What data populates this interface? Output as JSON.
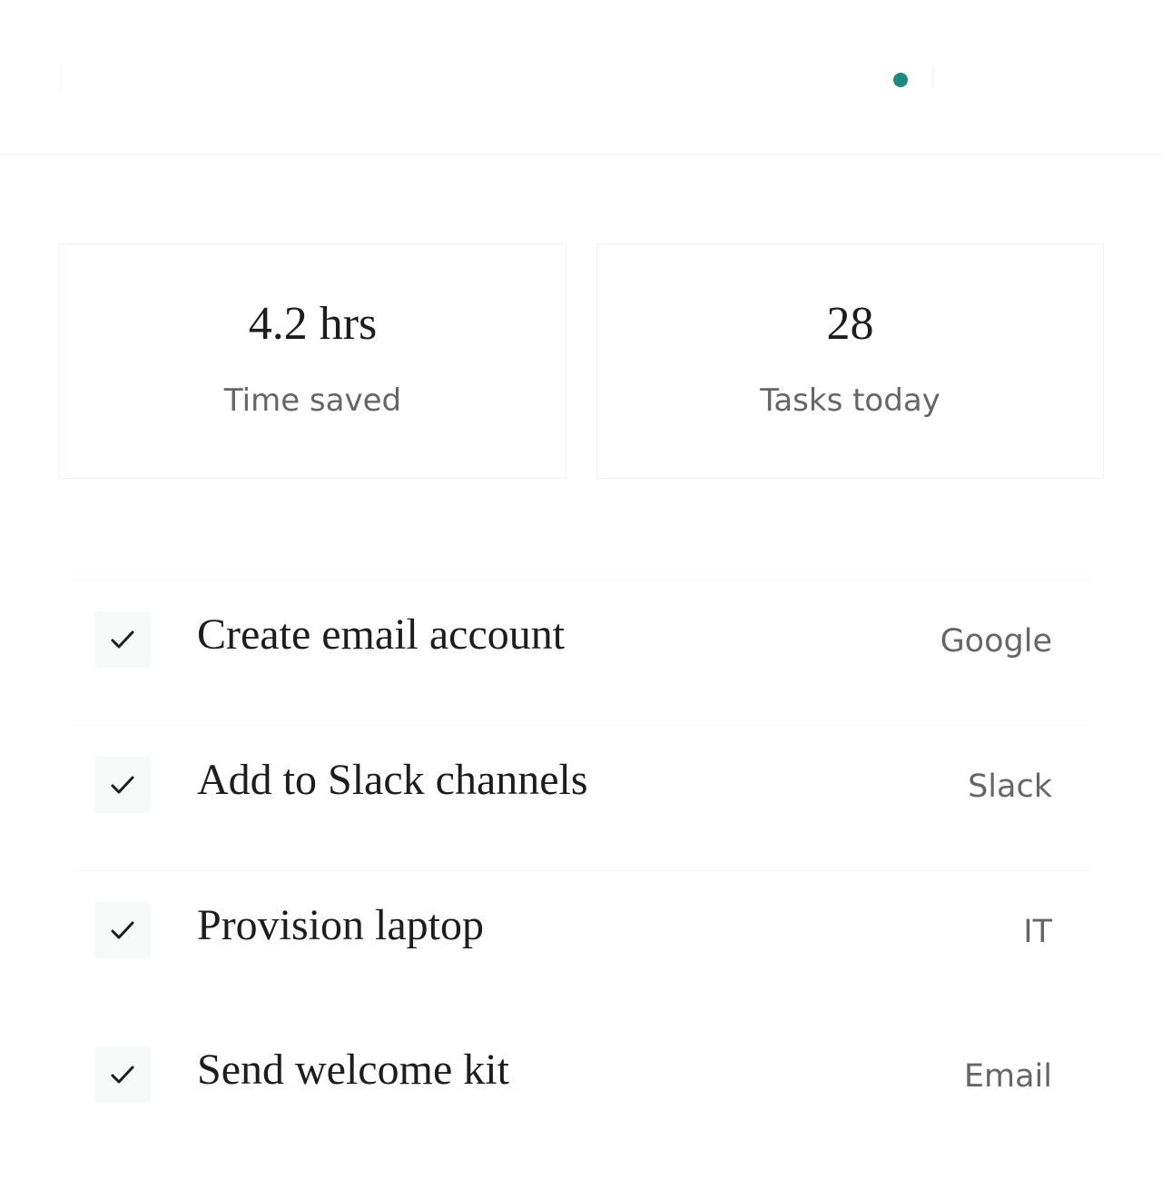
{
  "theme": {
    "accent": "#1e8a7e",
    "text_primary": "#1d1d1d",
    "text_secondary": "#666666",
    "check_bg": "#f6fbfa"
  },
  "header": {
    "status_indicator": {
      "color": "#1e8a7e",
      "state": "active"
    }
  },
  "stats": [
    {
      "value": "4.2 hrs",
      "label": "Time saved"
    },
    {
      "value": "28",
      "label": "Tasks today"
    }
  ],
  "tasks": [
    {
      "title": "Create email account",
      "source": "Google",
      "icon": "check-icon",
      "done": true
    },
    {
      "title": "Add to Slack channels",
      "source": "Slack",
      "icon": "check-icon",
      "done": true
    },
    {
      "title": "Provision laptop",
      "source": "IT",
      "icon": "check-icon",
      "done": true
    },
    {
      "title": "Send welcome kit",
      "source": "Email",
      "icon": "check-icon",
      "done": true
    }
  ]
}
